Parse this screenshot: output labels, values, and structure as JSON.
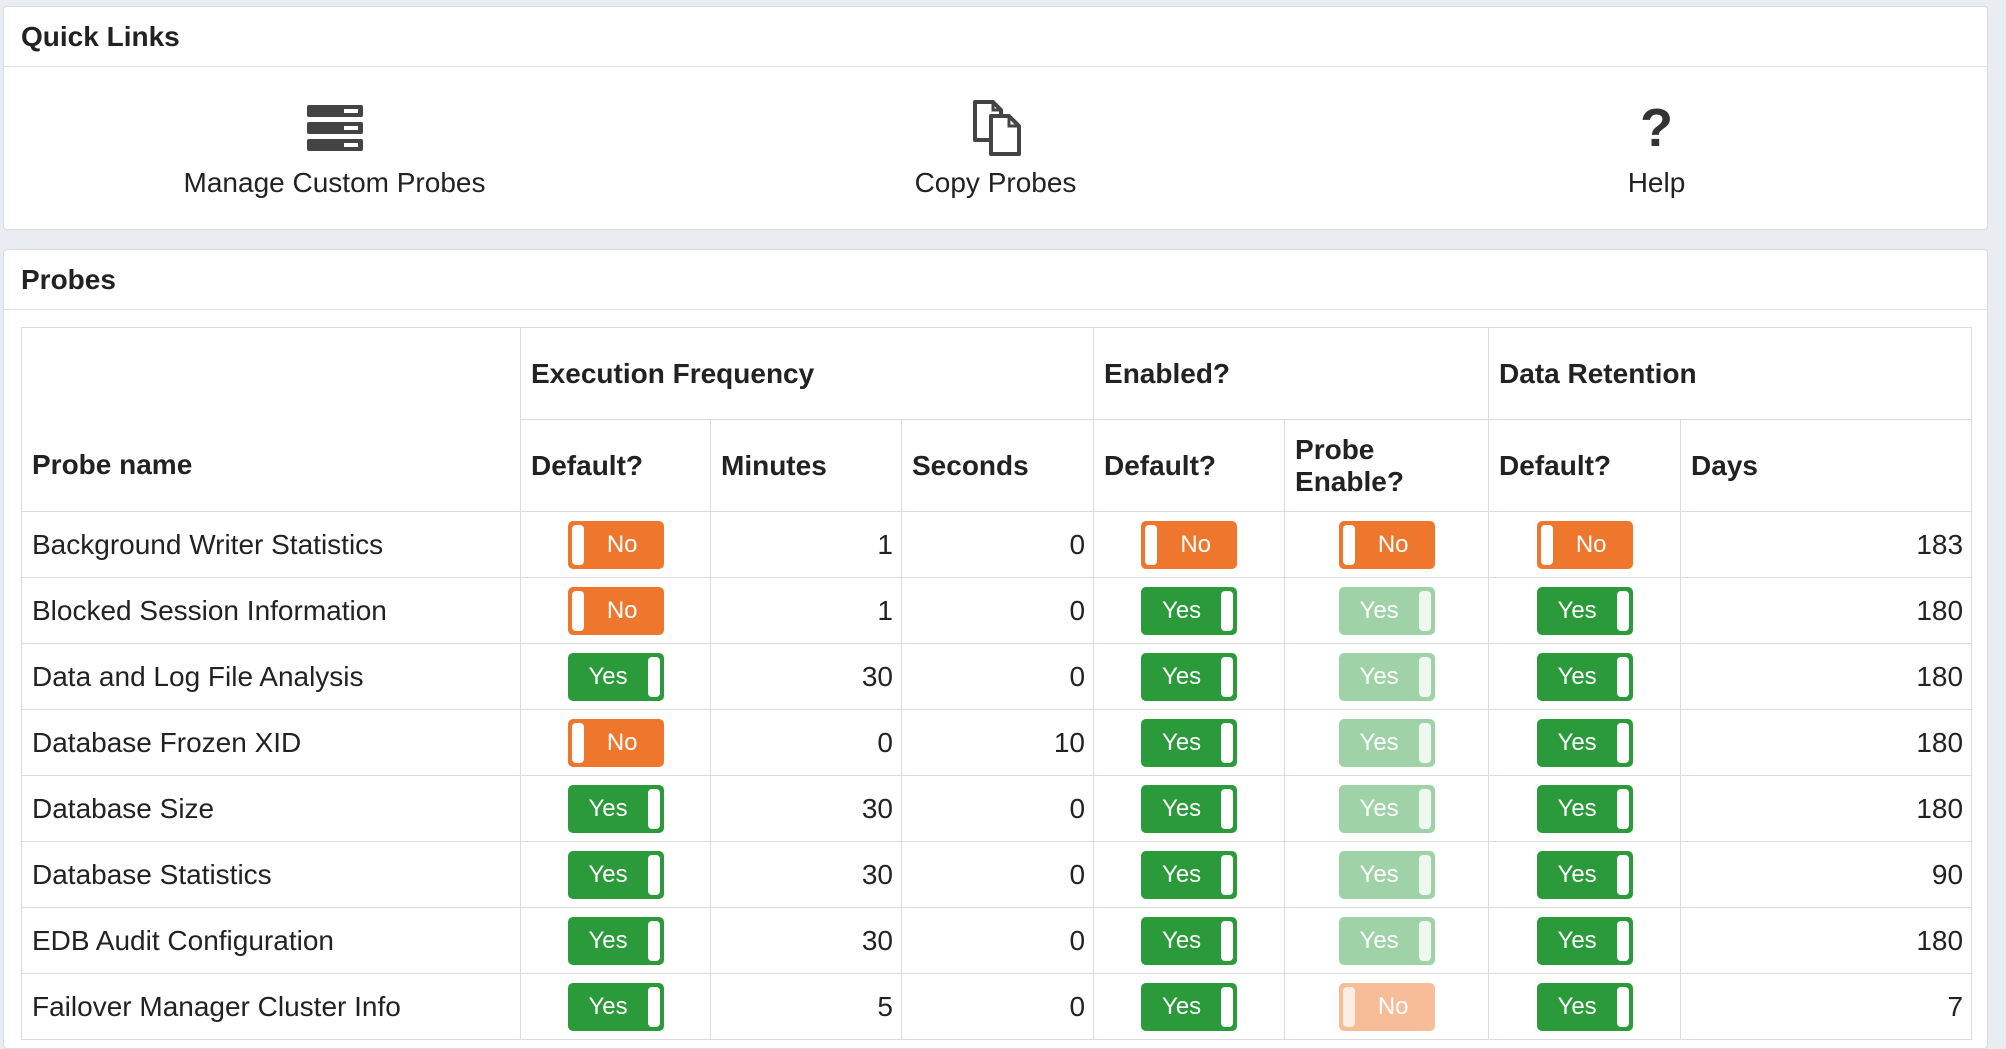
{
  "quick_links": {
    "title": "Quick Links",
    "items": [
      {
        "label": "Manage Custom Probes",
        "icon": "server-stack-icon"
      },
      {
        "label": "Copy Probes",
        "icon": "copy-icon"
      },
      {
        "label": "Help",
        "icon": "help-icon",
        "glyph": "?"
      }
    ]
  },
  "probes": {
    "title": "Probes",
    "headers": {
      "probe_name": "Probe name",
      "execution_frequency": "Execution Frequency",
      "enabled": "Enabled?",
      "data_retention": "Data Retention",
      "default": "Default?",
      "minutes": "Minutes",
      "seconds": "Seconds",
      "probe_enable": "Probe Enable?",
      "days": "Days"
    },
    "rows": [
      {
        "name": "Background Writer Statistics",
        "freq_default": "No",
        "minutes": "1",
        "seconds": "0",
        "enabled_default": "No",
        "probe_enable": "No",
        "probe_enable_disabled": false,
        "retention_default": "No",
        "days": "183"
      },
      {
        "name": "Blocked Session Information",
        "freq_default": "No",
        "minutes": "1",
        "seconds": "0",
        "enabled_default": "Yes",
        "probe_enable": "Yes",
        "probe_enable_disabled": true,
        "retention_default": "Yes",
        "days": "180"
      },
      {
        "name": "Data and Log File Analysis",
        "freq_default": "Yes",
        "minutes": "30",
        "seconds": "0",
        "enabled_default": "Yes",
        "probe_enable": "Yes",
        "probe_enable_disabled": true,
        "retention_default": "Yes",
        "days": "180"
      },
      {
        "name": "Database Frozen XID",
        "freq_default": "No",
        "minutes": "0",
        "seconds": "10",
        "enabled_default": "Yes",
        "probe_enable": "Yes",
        "probe_enable_disabled": true,
        "retention_default": "Yes",
        "days": "180"
      },
      {
        "name": "Database Size",
        "freq_default": "Yes",
        "minutes": "30",
        "seconds": "0",
        "enabled_default": "Yes",
        "probe_enable": "Yes",
        "probe_enable_disabled": true,
        "retention_default": "Yes",
        "days": "180"
      },
      {
        "name": "Database Statistics",
        "freq_default": "Yes",
        "minutes": "30",
        "seconds": "0",
        "enabled_default": "Yes",
        "probe_enable": "Yes",
        "probe_enable_disabled": true,
        "retention_default": "Yes",
        "days": "90"
      },
      {
        "name": "EDB Audit Configuration",
        "freq_default": "Yes",
        "minutes": "30",
        "seconds": "0",
        "enabled_default": "Yes",
        "probe_enable": "Yes",
        "probe_enable_disabled": true,
        "retention_default": "Yes",
        "days": "180"
      },
      {
        "name": "Failover Manager Cluster Info",
        "freq_default": "Yes",
        "minutes": "5",
        "seconds": "0",
        "enabled_default": "Yes",
        "probe_enable": "No",
        "probe_enable_disabled": true,
        "retention_default": "Yes",
        "days": "7"
      }
    ]
  },
  "colors": {
    "toggle_yes": "#2a9a3a",
    "toggle_no": "#ef772d",
    "toggle_yes_disabled": "#9fd3a7",
    "toggle_no_disabled": "#f7bc98"
  }
}
